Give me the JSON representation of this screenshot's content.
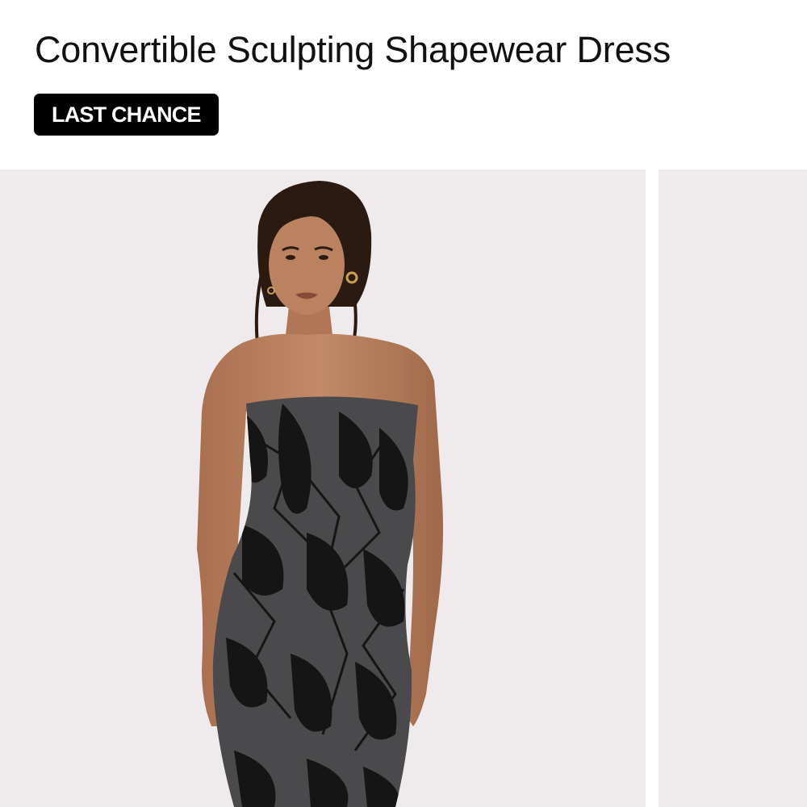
{
  "product": {
    "title": "Convertible Sculpting Shapewear Dress",
    "badge": "LAST CHANCE"
  },
  "gallery": {
    "images": [
      {
        "subject": "model wearing strapless black and grey tie-dye bodycon shapewear dress"
      },
      {
        "subject": "next product image (partially visible)"
      }
    ]
  },
  "colors": {
    "page_background": "#ffffff",
    "image_background": "#efebec",
    "badge_background": "#000000",
    "badge_text": "#ffffff",
    "dress_base": "#4a4a4c",
    "dress_pattern": "#151515",
    "skin": "#b98060",
    "hair": "#2a1a12"
  }
}
